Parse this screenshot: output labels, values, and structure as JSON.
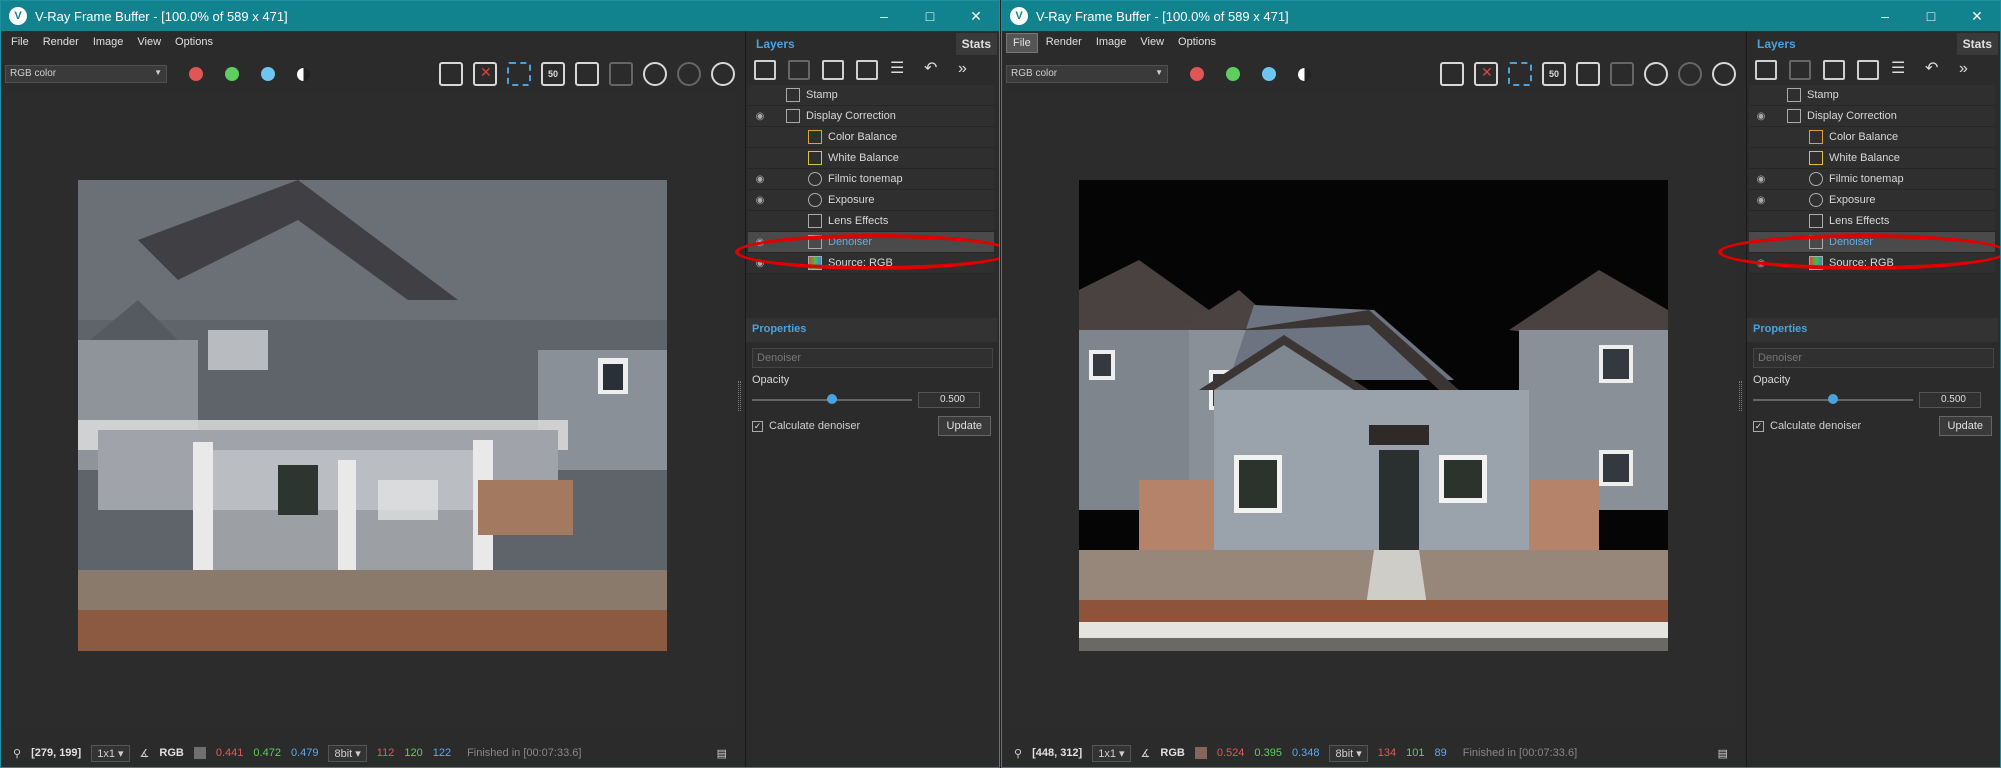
{
  "windows": [
    {
      "title": "V-Ray Frame Buffer - [100.0% of 589 x 471]",
      "menu": [
        "File",
        "Render",
        "Image",
        "View",
        "Options"
      ],
      "menu_selected": "",
      "channel": "RGB color",
      "status": {
        "coords": "[279, 199]",
        "sampling": "1x1",
        "mode": "RGB",
        "swatch_color": "#6f6f6f",
        "r": "0.441",
        "g": "0.472",
        "b": "0.479",
        "bits": "8bit",
        "r8": "112",
        "g8": "120",
        "b8": "122",
        "finished": "Finished in [00:07:33.6]"
      },
      "tabs": {
        "layers": "Layers",
        "stats": "Stats"
      },
      "layers": [
        {
          "label": "Stamp",
          "eye": false,
          "indent": 1
        },
        {
          "label": "Display Correction",
          "eye": true,
          "indent": 1
        },
        {
          "label": "Color Balance",
          "eye": false,
          "indent": 2
        },
        {
          "label": "White Balance",
          "eye": false,
          "indent": 2
        },
        {
          "label": "Filmic tonemap",
          "eye": true,
          "indent": 2
        },
        {
          "label": "Exposure",
          "eye": true,
          "indent": 2
        },
        {
          "label": "Lens Effects",
          "eye": false,
          "indent": 2
        },
        {
          "label": "Denoiser",
          "eye": true,
          "indent": 2,
          "selected": true
        },
        {
          "label": "Source: RGB",
          "eye": true,
          "indent": 2
        }
      ],
      "properties": {
        "header": "Properties",
        "name": "Denoiser",
        "opacity_label": "Opacity",
        "opacity_value": "0.500",
        "opacity_fraction": 0.5,
        "checkbox_label": "Calculate denoiser",
        "update_label": "Update"
      }
    },
    {
      "title": "V-Ray Frame Buffer - [100.0% of 589 x 471]",
      "menu": [
        "File",
        "Render",
        "Image",
        "View",
        "Options"
      ],
      "menu_selected": "File",
      "channel": "RGB color",
      "status": {
        "coords": "[448, 312]",
        "sampling": "1x1",
        "mode": "RGB",
        "swatch_color": "#86655a",
        "r": "0.524",
        "g": "0.395",
        "b": "0.348",
        "bits": "8bit",
        "r8": "134",
        "g8": "101",
        "b8": "89",
        "finished": "Finished in [00:07:33.6]"
      },
      "tabs": {
        "layers": "Layers",
        "stats": "Stats"
      },
      "layers": [
        {
          "label": "Stamp",
          "eye": false,
          "indent": 1
        },
        {
          "label": "Display Correction",
          "eye": true,
          "indent": 1
        },
        {
          "label": "Color Balance",
          "eye": false,
          "indent": 2
        },
        {
          "label": "White Balance",
          "eye": false,
          "indent": 2
        },
        {
          "label": "Filmic tonemap",
          "eye": true,
          "indent": 2
        },
        {
          "label": "Exposure",
          "eye": true,
          "indent": 2
        },
        {
          "label": "Lens Effects",
          "eye": false,
          "indent": 2
        },
        {
          "label": "Denoiser",
          "eye": false,
          "indent": 2,
          "selected": true
        },
        {
          "label": "Source: RGB",
          "eye": true,
          "indent": 2
        }
      ],
      "properties": {
        "header": "Properties",
        "name": "Denoiser",
        "opacity_label": "Opacity",
        "opacity_value": "0.500",
        "opacity_fraction": 0.5,
        "checkbox_label": "Calculate denoiser",
        "update_label": "Update"
      }
    }
  ]
}
